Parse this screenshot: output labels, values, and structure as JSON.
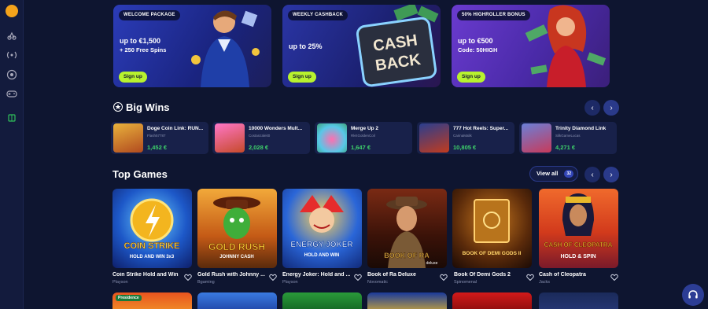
{
  "colors": {
    "background": "#0e1530",
    "accent": "#b8f22f",
    "win_green": "#3ed36b",
    "nav": "#2a3a8a"
  },
  "sidebar": {
    "icons": [
      "logo-icon",
      "sports-icon",
      "live-icon",
      "football-icon",
      "gamepad-icon",
      "gift-icon"
    ]
  },
  "promos": [
    {
      "tag": "WELCOME PACKAGE",
      "title": "up to €1,500",
      "subtitle": "+ 250 Free Spins",
      "button": "Sign up"
    },
    {
      "tag": "WEEKLY CASHBACK",
      "title": "up to 25%",
      "subtitle": "",
      "button": "Sign up",
      "art_text_1": "CASH",
      "art_text_2": "BACK"
    },
    {
      "tag": "50% HIGHROLLER BONUS",
      "title": "up to €500",
      "subtitle": "Code: 50HIGH",
      "button": "Sign up"
    }
  ],
  "big_wins": {
    "title": "Big Wins",
    "items": [
      {
        "game": "Doge Coin Link: RUN...",
        "user": "Flash57787",
        "amount": "1,452 €"
      },
      {
        "game": "10000 Wonders Mult...",
        "user": "Costanzaleit0",
        "amount": "2,028 €"
      },
      {
        "game": "Merge Up 2",
        "user": "RkKGoldenCoil",
        "amount": "1,647 €"
      },
      {
        "game": "777 Hot Reels: Super...",
        "user": "CarinaMalik",
        "amount": "10,805 €"
      },
      {
        "game": "Trinity Diamond Link",
        "user": "SilkGameLucas",
        "amount": "4,271 €"
      }
    ]
  },
  "top_games": {
    "title": "Top Games",
    "view_all": "View all",
    "count": "32",
    "items": [
      {
        "name": "Coin Strike Hold and Win",
        "provider": "Playson",
        "art": "COIN STRIKE",
        "art_sub": "HOLD AND WIN 3x3"
      },
      {
        "name": "Gold Rush with Johnny ...",
        "provider": "Bgaming",
        "art": "GOLD RUSH",
        "art_sub": "JOHNNY CASH"
      },
      {
        "name": "Energy Joker: Hold and ...",
        "provider": "Playson",
        "art": "ENERGY JOKER",
        "art_sub": "HOLD AND WIN"
      },
      {
        "name": "Book of Ra Deluxe",
        "provider": "Novomatic",
        "art": "BOOK OF RA",
        "art_sub": "deluxe"
      },
      {
        "name": "Book Of Demi Gods 2",
        "provider": "Spinomenal",
        "art": "BOOK OF DEMI GODS II",
        "art_sub": ""
      },
      {
        "name": "Cash of Cleopatra",
        "provider": "Jacks",
        "art": "CASH OF CLEOPATRA",
        "art_sub": "HOLD & SPIN"
      }
    ],
    "row2_badge": "Presidence"
  }
}
